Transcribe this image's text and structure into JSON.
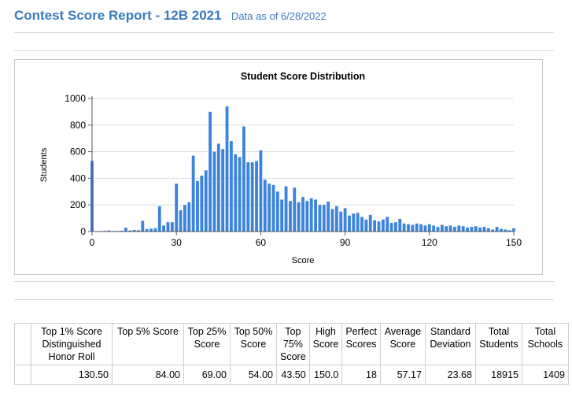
{
  "header": {
    "title": "Contest Score Report -  12B 2021",
    "as_of": "Data as of 6/28/2022"
  },
  "chart_data": {
    "type": "bar",
    "title": "Student Score Distribution",
    "xlabel": "Score",
    "ylabel": "Students",
    "xlim": [
      0,
      150
    ],
    "ylim": [
      0,
      1000
    ],
    "x_ticks": [
      "0",
      "30",
      "60",
      "90",
      "120",
      "150"
    ],
    "y_ticks": [
      "0",
      "200",
      "400",
      "600",
      "800",
      "1000"
    ],
    "grid": true,
    "color": "#3c84dc",
    "x": [
      0,
      1.5,
      3,
      4.5,
      6,
      7.5,
      9,
      10.5,
      12,
      13.5,
      15,
      16.5,
      18,
      19.5,
      21,
      22.5,
      24,
      25.5,
      27,
      28.5,
      30,
      31.5,
      33,
      34.5,
      36,
      37.5,
      39,
      40.5,
      42,
      43.5,
      45,
      46.5,
      48,
      49.5,
      51,
      52.5,
      54,
      55.5,
      57,
      58.5,
      60,
      61.5,
      63,
      64.5,
      66,
      67.5,
      69,
      70.5,
      72,
      73.5,
      75,
      76.5,
      78,
      79.5,
      81,
      82.5,
      84,
      85.5,
      87,
      88.5,
      90,
      91.5,
      93,
      94.5,
      96,
      97.5,
      99,
      100.5,
      102,
      103.5,
      105,
      106.5,
      108,
      109.5,
      111,
      112.5,
      114,
      115.5,
      117,
      118.5,
      120,
      121.5,
      123,
      124.5,
      126,
      127.5,
      129,
      130.5,
      132,
      133.5,
      135,
      136.5,
      138,
      139.5,
      141,
      142.5,
      144,
      145.5,
      147,
      148.5,
      150
    ],
    "values": [
      530,
      2,
      3,
      5,
      8,
      4,
      4,
      6,
      28,
      8,
      12,
      10,
      80,
      18,
      22,
      25,
      190,
      45,
      70,
      70,
      360,
      160,
      200,
      220,
      570,
      380,
      420,
      460,
      900,
      600,
      660,
      620,
      940,
      680,
      580,
      560,
      790,
      520,
      520,
      530,
      610,
      390,
      360,
      350,
      300,
      240,
      340,
      230,
      330,
      220,
      260,
      230,
      250,
      240,
      200,
      200,
      225,
      170,
      190,
      150,
      175,
      120,
      135,
      140,
      110,
      90,
      125,
      85,
      75,
      90,
      110,
      65,
      70,
      95,
      60,
      55,
      50,
      60,
      55,
      45,
      55,
      45,
      35,
      50,
      40,
      45,
      35,
      45,
      40,
      30,
      35,
      40,
      30,
      35,
      25,
      15,
      35,
      20,
      15,
      10,
      25
    ]
  },
  "table": {
    "headers": [
      "Top 1% Score Distinguished Honor Roll",
      "Top 5% Score",
      "Top 25% Score",
      "Top 50% Score",
      "Top 75% Score",
      "High Score",
      "Perfect Scores",
      "Average Score",
      "Standard Deviation",
      "Total Students",
      "Total Schools"
    ],
    "values": [
      "130.50",
      "84.00",
      "69.00",
      "54.00",
      "43.50",
      "150.0",
      "18",
      "57.17",
      "23.68",
      "18915",
      "1409"
    ]
  }
}
